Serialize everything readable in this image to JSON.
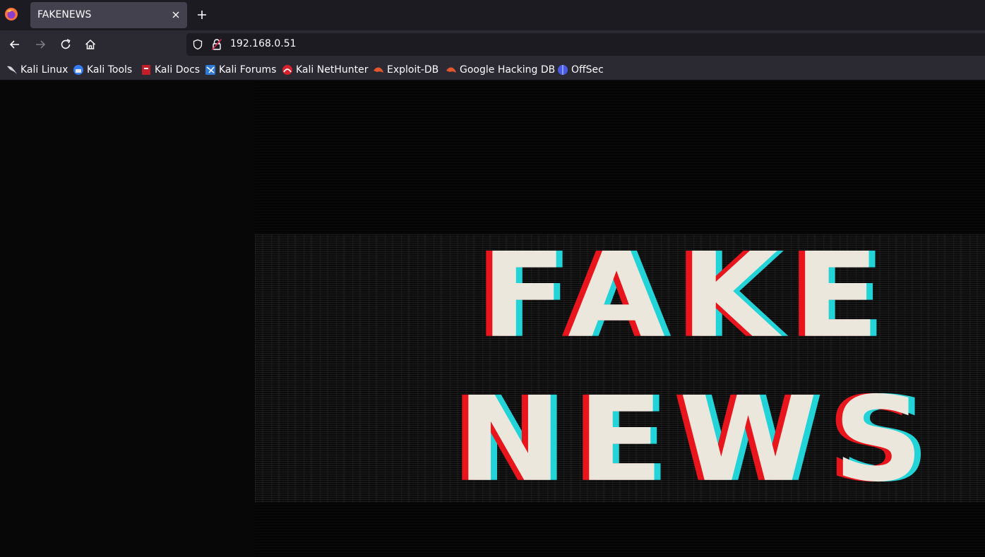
{
  "browser": {
    "tab": {
      "title": "FAKENEWS"
    },
    "url": "192.168.0.51",
    "bookmarks": [
      {
        "label": "Kali Linux",
        "icon": "kali-dragon-icon"
      },
      {
        "label": "Kali Tools",
        "icon": "kali-tools-icon"
      },
      {
        "label": "Kali Docs",
        "icon": "kali-docs-icon"
      },
      {
        "label": "Kali Forums",
        "icon": "kali-forums-icon"
      },
      {
        "label": "Kali NetHunter",
        "icon": "kali-nethunter-icon"
      },
      {
        "label": "Exploit-DB",
        "icon": "exploit-db-icon"
      },
      {
        "label": "Google Hacking DB",
        "icon": "google-hacking-db-icon"
      },
      {
        "label": "OffSec",
        "icon": "offsec-icon"
      }
    ]
  },
  "page": {
    "headline_line1": "FAKE",
    "headline_line2": "NEWS"
  },
  "colors": {
    "glitch_red": "#e8151c",
    "glitch_cyan": "#22d3d8",
    "text_cream": "#ece7dc"
  }
}
